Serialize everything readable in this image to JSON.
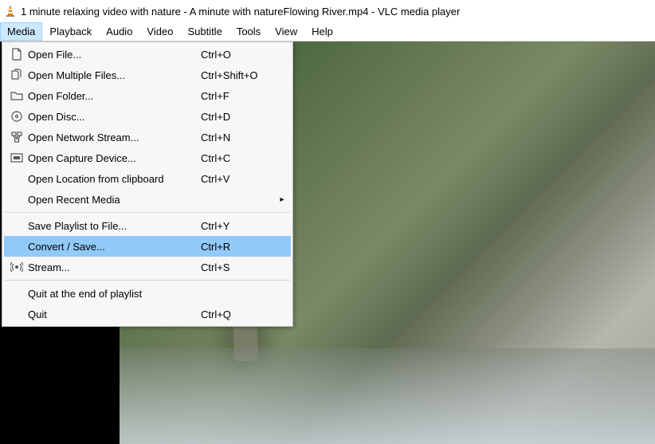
{
  "title": "1 minute relaxing video with nature - A minute with natureFlowing River.mp4 - VLC media player",
  "menubar": {
    "items": [
      {
        "label": "Media",
        "open": true
      },
      {
        "label": "Playback"
      },
      {
        "label": "Audio"
      },
      {
        "label": "Video"
      },
      {
        "label": "Subtitle"
      },
      {
        "label": "Tools"
      },
      {
        "label": "View"
      },
      {
        "label": "Help"
      }
    ]
  },
  "media_menu": {
    "groups": [
      [
        {
          "icon": "file-icon",
          "label": "Open File...",
          "shortcut": "Ctrl+O"
        },
        {
          "icon": "files-icon",
          "label": "Open Multiple Files...",
          "shortcut": "Ctrl+Shift+O"
        },
        {
          "icon": "folder-icon",
          "label": "Open Folder...",
          "shortcut": "Ctrl+F"
        },
        {
          "icon": "disc-icon",
          "label": "Open Disc...",
          "shortcut": "Ctrl+D"
        },
        {
          "icon": "network-icon",
          "label": "Open Network Stream...",
          "shortcut": "Ctrl+N"
        },
        {
          "icon": "capture-icon",
          "label": "Open Capture Device...",
          "shortcut": "Ctrl+C"
        },
        {
          "icon": "",
          "label": "Open Location from clipboard",
          "shortcut": "Ctrl+V"
        },
        {
          "icon": "",
          "label": "Open Recent Media",
          "shortcut": "",
          "submenu": true
        }
      ],
      [
        {
          "icon": "",
          "label": "Save Playlist to File...",
          "shortcut": "Ctrl+Y"
        },
        {
          "icon": "",
          "label": "Convert / Save...",
          "shortcut": "Ctrl+R",
          "highlight": true
        },
        {
          "icon": "stream-icon",
          "label": "Stream...",
          "shortcut": "Ctrl+S"
        }
      ],
      [
        {
          "icon": "",
          "label": "Quit at the end of playlist",
          "shortcut": ""
        },
        {
          "icon": "",
          "label": "Quit",
          "shortcut": "Ctrl+Q"
        }
      ]
    ]
  }
}
